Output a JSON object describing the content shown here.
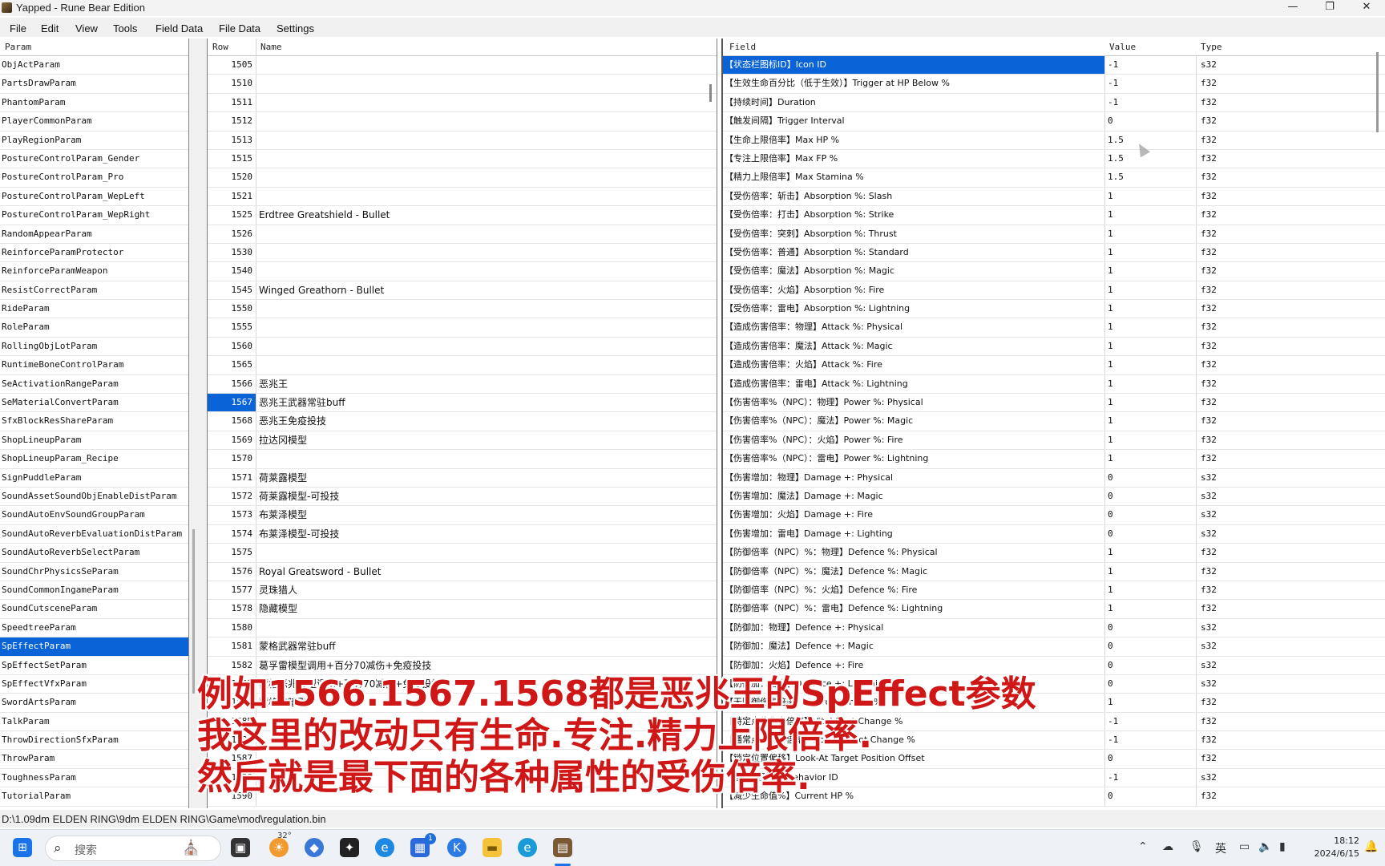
{
  "window": {
    "title": "Yapped - Rune Bear Edition",
    "minimize": "—",
    "maximize": "❐",
    "close": "✕"
  },
  "menu": [
    "File",
    "Edit",
    "View",
    "Tools",
    "Field Data",
    "File Data",
    "Settings"
  ],
  "params": {
    "header": "Param",
    "selected_index": 31,
    "items": [
      "ObjActParam",
      "PartsDrawParam",
      "PhantomParam",
      "PlayerCommonParam",
      "PlayRegionParam",
      "PostureControlParam_Gender",
      "PostureControlParam_Pro",
      "PostureControlParam_WepLeft",
      "PostureControlParam_WepRight",
      "RandomAppearParam",
      "ReinforceParamProtector",
      "ReinforceParamWeapon",
      "ResistCorrectParam",
      "RideParam",
      "RoleParam",
      "RollingObjLotParam",
      "RuntimeBoneControlParam",
      "SeActivationRangeParam",
      "SeMaterialConvertParam",
      "SfxBlockResShareParam",
      "ShopLineupParam",
      "ShopLineupParam_Recipe",
      "SignPuddleParam",
      "SoundAssetSoundObjEnableDistParam",
      "SoundAutoEnvSoundGroupParam",
      "SoundAutoReverbEvaluationDistParam",
      "SoundAutoReverbSelectParam",
      "SoundChrPhysicsSeParam",
      "SoundCommonIngameParam",
      "SoundCutsceneParam",
      "SpeedtreeParam",
      "SpEffectParam",
      "SpEffectSetParam",
      "SpEffectVfxParam",
      "SwordArtsParam",
      "TalkParam",
      "ThrowDirectionSfxParam",
      "ThrowParam",
      "ToughnessParam",
      "TutorialParam"
    ]
  },
  "rows": {
    "header_row": "Row",
    "header_name": "Name",
    "selected_index": 18,
    "items": [
      {
        "id": "1505",
        "name": ""
      },
      {
        "id": "1510",
        "name": ""
      },
      {
        "id": "1511",
        "name": ""
      },
      {
        "id": "1512",
        "name": ""
      },
      {
        "id": "1513",
        "name": ""
      },
      {
        "id": "1515",
        "name": ""
      },
      {
        "id": "1520",
        "name": ""
      },
      {
        "id": "1521",
        "name": ""
      },
      {
        "id": "1525",
        "name": "Erdtree Greatshield - Bullet"
      },
      {
        "id": "1526",
        "name": ""
      },
      {
        "id": "1530",
        "name": ""
      },
      {
        "id": "1540",
        "name": ""
      },
      {
        "id": "1545",
        "name": "Winged Greathorn - Bullet"
      },
      {
        "id": "1550",
        "name": ""
      },
      {
        "id": "1555",
        "name": ""
      },
      {
        "id": "1560",
        "name": ""
      },
      {
        "id": "1565",
        "name": ""
      },
      {
        "id": "1566",
        "name": "恶兆王"
      },
      {
        "id": "1567",
        "name": "恶兆王武器常驻buff"
      },
      {
        "id": "1568",
        "name": "恶兆王免疫投技"
      },
      {
        "id": "1569",
        "name": "拉达冈模型"
      },
      {
        "id": "1570",
        "name": ""
      },
      {
        "id": "1571",
        "name": "荷莱露模型"
      },
      {
        "id": "1572",
        "name": "荷莱露模型-可投技"
      },
      {
        "id": "1573",
        "name": "布莱泽模型"
      },
      {
        "id": "1574",
        "name": "布莱泽模型-可投技"
      },
      {
        "id": "1575",
        "name": ""
      },
      {
        "id": "1576",
        "name": "Royal Greatsword - Bullet"
      },
      {
        "id": "1577",
        "name": "灵珠猎人"
      },
      {
        "id": "1578",
        "name": "隐藏模型"
      },
      {
        "id": "1580",
        "name": ""
      },
      {
        "id": "1581",
        "name": "蒙格武器常驻buff"
      },
      {
        "id": "1582",
        "name": "葛孚雷模型调用+百分70减伤+免疫投技"
      },
      {
        "id": "1583",
        "name": "蒙格恶兆模型调用+百分70减伤+免疫投技"
      },
      {
        "id": "1584",
        "name": "蒙格的暗影"
      },
      {
        "id": "1585",
        "name": ""
      },
      {
        "id": "1586",
        "name": ""
      },
      {
        "id": "1587",
        "name": ""
      },
      {
        "id": "1588",
        "name": ""
      },
      {
        "id": "1590",
        "name": ""
      }
    ]
  },
  "fields": {
    "header_field": "Field",
    "header_value": "Value",
    "header_type": "Type",
    "selected_index": 0,
    "items": [
      {
        "field": "【状态栏图标ID】Icon ID",
        "value": "-1",
        "type": "s32"
      },
      {
        "field": "【生效生命百分比（低于生效）】Trigger at HP Below %",
        "value": "-1",
        "type": "f32"
      },
      {
        "field": "【持续时间】Duration",
        "value": "-1",
        "type": "f32"
      },
      {
        "field": "【触发间隔】Trigger Interval",
        "value": "0",
        "type": "f32"
      },
      {
        "field": "【生命上限倍率】Max HP %",
        "value": "1.5",
        "type": "f32"
      },
      {
        "field": "【专注上限倍率】Max FP %",
        "value": "1.5",
        "type": "f32"
      },
      {
        "field": "【精力上限倍率】Max Stamina %",
        "value": "1.5",
        "type": "f32"
      },
      {
        "field": "【受伤倍率：斩击】Absorption %: Slash",
        "value": "1",
        "type": "f32"
      },
      {
        "field": "【受伤倍率：打击】Absorption %: Strike",
        "value": "1",
        "type": "f32"
      },
      {
        "field": "【受伤倍率：突刺】Absorption %: Thrust",
        "value": "1",
        "type": "f32"
      },
      {
        "field": "【受伤倍率：普通】Absorption %: Standard",
        "value": "1",
        "type": "f32"
      },
      {
        "field": "【受伤倍率：魔法】Absorption %: Magic",
        "value": "1",
        "type": "f32"
      },
      {
        "field": "【受伤倍率：火焰】Absorption %: Fire",
        "value": "1",
        "type": "f32"
      },
      {
        "field": "【受伤倍率：雷电】Absorption %: Lightning",
        "value": "1",
        "type": "f32"
      },
      {
        "field": "【造成伤害倍率：物理】Attack %: Physical",
        "value": "1",
        "type": "f32"
      },
      {
        "field": "【造成伤害倍率：魔法】Attack %: Magic",
        "value": "1",
        "type": "f32"
      },
      {
        "field": "【造成伤害倍率：火焰】Attack %: Fire",
        "value": "1",
        "type": "f32"
      },
      {
        "field": "【造成伤害倍率：雷电】Attack %: Lightning",
        "value": "1",
        "type": "f32"
      },
      {
        "field": "【伤害倍率%（NPC）：物理】Power %: Physical",
        "value": "1",
        "type": "f32"
      },
      {
        "field": "【伤害倍率%（NPC）：魔法】Power %: Magic",
        "value": "1",
        "type": "f32"
      },
      {
        "field": "【伤害倍率%（NPC）：火焰】Power %: Fire",
        "value": "1",
        "type": "f32"
      },
      {
        "field": "【伤害倍率%（NPC）：雷电】Power %: Lightning",
        "value": "1",
        "type": "f32"
      },
      {
        "field": "【伤害增加：物理】Damage +: Physical",
        "value": "0",
        "type": "s32"
      },
      {
        "field": "【伤害增加：魔法】Damage +: Magic",
        "value": "0",
        "type": "s32"
      },
      {
        "field": "【伤害增加：火焰】Damage +: Fire",
        "value": "0",
        "type": "s32"
      },
      {
        "field": "【伤害增加：雷电】Damage +: Lighting",
        "value": "0",
        "type": "s32"
      },
      {
        "field": "【防御倍率（NPC）%：物理】Defence %: Physical",
        "value": "1",
        "type": "f32"
      },
      {
        "field": "【防御倍率（NPC）%：魔法】Defence %: Magic",
        "value": "1",
        "type": "f32"
      },
      {
        "field": "【防御倍率（NPC）%：火焰】Defence %: Fire",
        "value": "1",
        "type": "f32"
      },
      {
        "field": "【防御倍率（NPC）%：雷电】Defence %: Lightning",
        "value": "1",
        "type": "f32"
      },
      {
        "field": "【防御加：物理】Defence +: Physical",
        "value": "0",
        "type": "s32"
      },
      {
        "field": "【防御加：魔法】Defence +: Magic",
        "value": "0",
        "type": "s32"
      },
      {
        "field": "【防御加：火焰】Defence +: Fire",
        "value": "0",
        "type": "s32"
      },
      {
        "field": "【防御加：雷电】Defence +: Lightning",
        "value": "0",
        "type": "s32"
      },
      {
        "field": "【无防御伤害倍率】Guard Damage %",
        "value": "1",
        "type": "f32"
      },
      {
        "field": "【特定点位伤害倍率】Vital Spot Change %",
        "value": "-1",
        "type": "f32"
      },
      {
        "field": "【通常点位伤害倍率】Normal Spot Change %",
        "value": "-1",
        "type": "f32"
      },
      {
        "field": "【锁定位置偏移】Look-At Target Position Offset",
        "value": "0",
        "type": "f32"
      },
      {
        "field": "【替换模型ID】Behavior ID",
        "value": "-1",
        "type": "s32"
      },
      {
        "field": "【减少生命值%】Current HP %",
        "value": "0",
        "type": "f32"
      }
    ]
  },
  "status": {
    "path": "D:\\1.09dm ELDEN RING\\9dm ELDEN RING\\Game\\mod\\regulation.bin"
  },
  "subtitle": [
    "例如1566.1567.1568都是恶兆王的SpEffect参数",
    "我这里的改动只有生命.专注.精力上限倍率.",
    "然后就是最下面的各种属性的受伤倍率."
  ],
  "taskbar": {
    "search_placeholder": "搜索",
    "weather_temp": "32°",
    "ime": "英",
    "time": "18:12",
    "date": "2024/6/15",
    "badge": "1",
    "accent": "#0a64d8"
  }
}
